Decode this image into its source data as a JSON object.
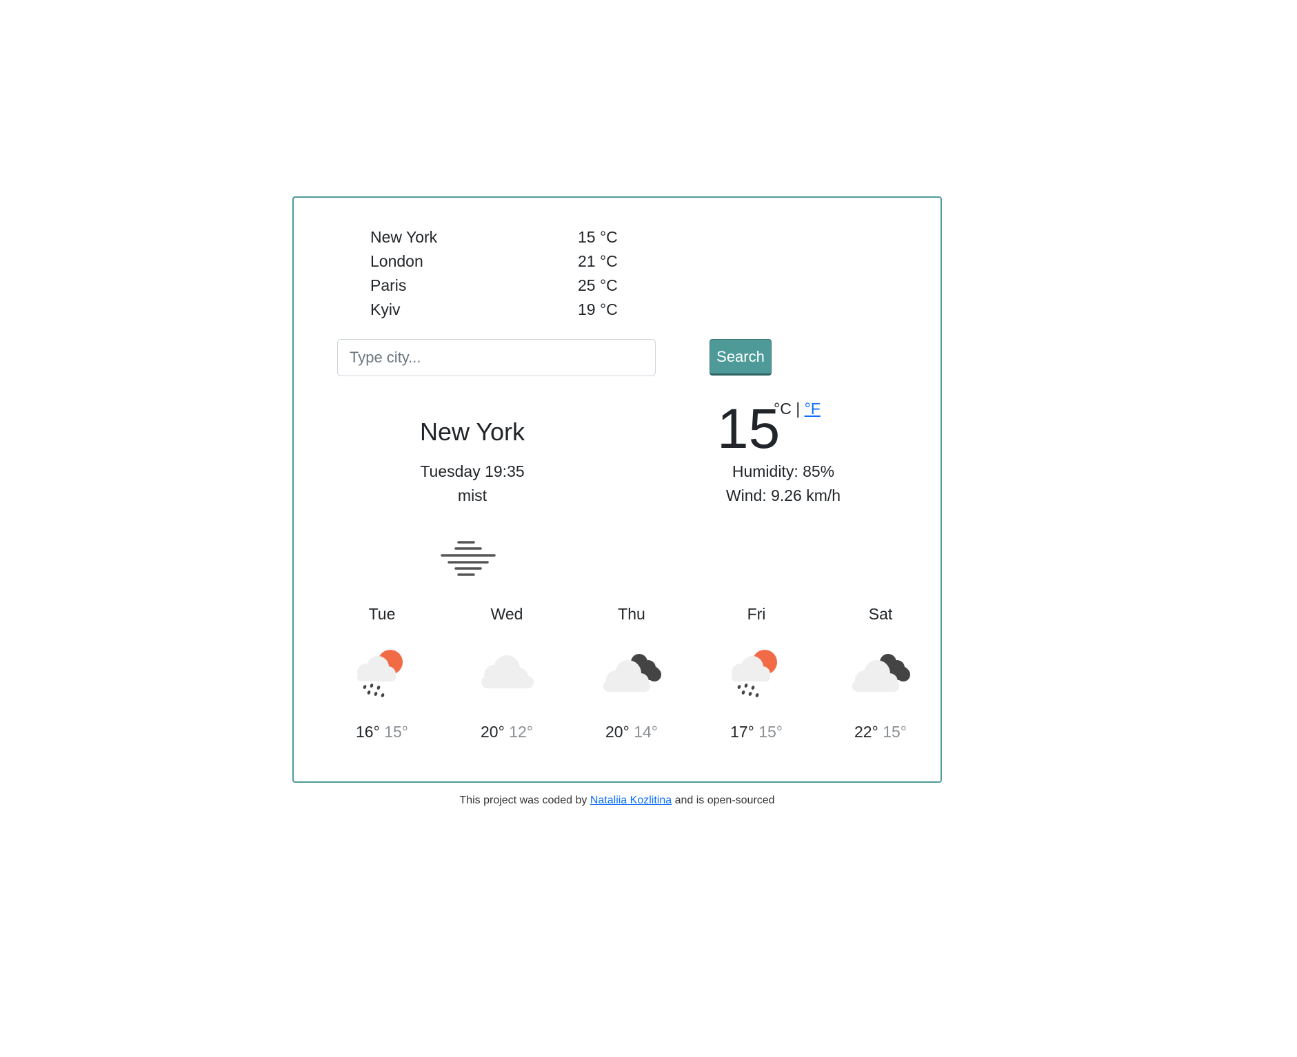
{
  "cities": [
    {
      "name": "New York",
      "temp": "15 °C"
    },
    {
      "name": "London",
      "temp": "21 °C"
    },
    {
      "name": "Paris",
      "temp": "25 °C"
    },
    {
      "name": "Kyiv",
      "temp": "19 °C"
    }
  ],
  "search": {
    "placeholder": "Type city...",
    "button_label": "Search"
  },
  "current": {
    "city": "New York",
    "datetime": "Tuesday 19:35",
    "description": "mist",
    "icon": "mist-icon",
    "temperature": "15",
    "unit_celsius": "°C",
    "unit_separator": " | ",
    "unit_fahrenheit": "°F",
    "humidity": "Humidity: 85%",
    "wind": "Wind: 9.26 km/h"
  },
  "forecast": [
    {
      "day": "Tue",
      "max": "16°",
      "min": "15°",
      "icon": "rain-sun-icon"
    },
    {
      "day": "Wed",
      "max": "20°",
      "min": "12°",
      "icon": "cloud-icon"
    },
    {
      "day": "Thu",
      "max": "20°",
      "min": "14°",
      "icon": "broken-clouds-icon"
    },
    {
      "day": "Fri",
      "max": "17°",
      "min": "15°",
      "icon": "rain-sun-icon"
    },
    {
      "day": "Sat",
      "max": "22°",
      "min": "15°",
      "icon": "broken-clouds-icon"
    }
  ],
  "footer": {
    "prefix": "This project was coded by ",
    "author_link": "Nataliia Kozlitina",
    "middle": " and is ",
    "source_link": "open-sourced"
  },
  "colors": {
    "accent": "#4d9a99",
    "link": "#0d6efd",
    "sun": "#f26b47",
    "cloud_light": "#efefef",
    "cloud_dark": "#444444"
  }
}
